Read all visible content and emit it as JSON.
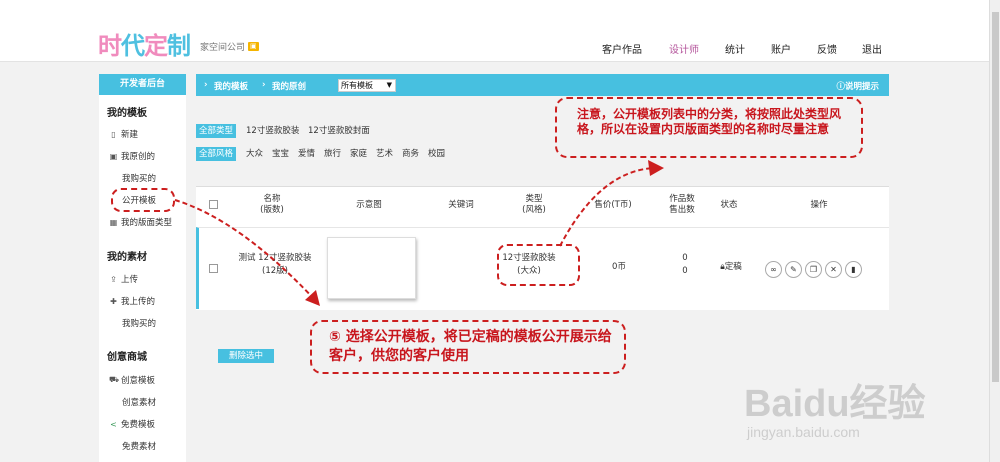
{
  "header": {
    "logo": "时代定制",
    "shop_name": "家空间公司",
    "shop_badge": "🪪",
    "nav": [
      "客户作品",
      "设计师",
      "统计",
      "账户",
      "反馈",
      "退出"
    ],
    "nav_active": "设计师"
  },
  "sidebar": {
    "title": "开发者后台",
    "sections": {
      "my_templates": "我的模板",
      "my_materials": "我的素材",
      "creative_mall": "创意商城"
    },
    "items": {
      "new": "新建",
      "my_original": "我原创的",
      "my_purchased": "我购买的",
      "public_templates": "公开模板",
      "my_layout_types": "我的版面类型",
      "upload": "上传",
      "my_uploaded": "我上传的",
      "material_purchased": "我购买的",
      "creative_templates": "创意模板",
      "creative_materials": "创意素材",
      "free_templates": "免费模板",
      "free_materials": "免费素材"
    }
  },
  "main": {
    "breadcrumb": {
      "my_templates": "我的模板",
      "my_original": "我的原创",
      "select_value": "所有模板",
      "help": "说明提示"
    },
    "filters": {
      "type_label": "全部类型",
      "types": [
        "12寸竖款胶装",
        "12寸竖款胶封面"
      ],
      "style_label": "全部风格",
      "styles": [
        "大众",
        "宝宝",
        "爱情",
        "旅行",
        "家庭",
        "艺术",
        "商务",
        "校园"
      ]
    },
    "table": {
      "headers": {
        "name": "名称",
        "name_sub": "(版数)",
        "preview": "示意图",
        "keywords": "关键词",
        "type": "类型",
        "type_sub": "(风格)",
        "price": "售价(T币)",
        "works_count": "作品数",
        "sold_count": "售出数",
        "status": "状态",
        "actions": "操作"
      },
      "rows": [
        {
          "name": "测试 12寸竖款胶装",
          "pages": "(12版)",
          "type": "12寸竖款胶装",
          "style": "(大众)",
          "price": "0币",
          "works": "0",
          "sold": "0",
          "status": "定稿"
        }
      ]
    },
    "delete_button": "删除选中"
  },
  "annotations": {
    "note1": "注意，公开模板列表中的分类，将按照此处类型风格，所以在设置内页版面类型的名称时尽量注意",
    "note2": "⑤ 选择公开模板，将已定稿的模板公开展示给客户，供您的客户使用"
  },
  "watermark": {
    "logo": "Baidu经验",
    "url": "jingyan.baidu.com"
  },
  "colors": {
    "accent": "#47c0e0",
    "brand_pink": "#f08bbd",
    "annotation_red": "#c8161d",
    "nav_active": "#b4549b"
  }
}
